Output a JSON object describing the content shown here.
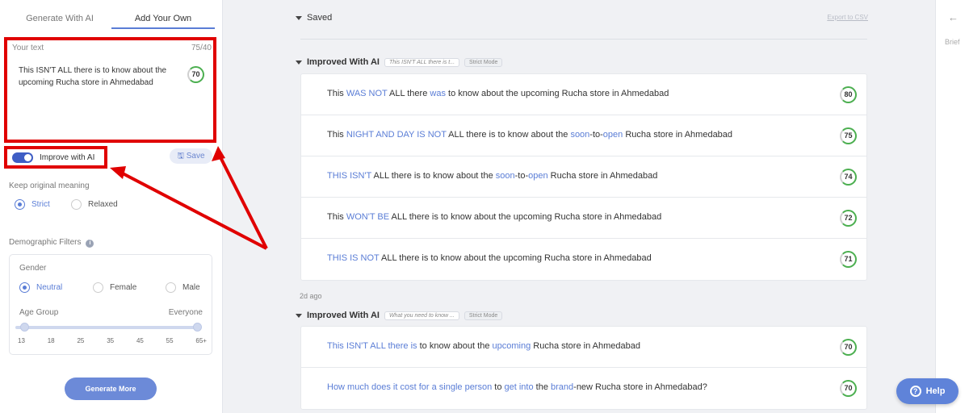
{
  "left": {
    "tabs": [
      "Generate With AI",
      "Add Your Own"
    ],
    "text_label": "Your text",
    "char_count": "75/40",
    "text_value": "This ISN'T ALL there is to know about the upcoming Rucha store in Ahmedabad",
    "text_score": "70",
    "improve_label": "Improve with AI",
    "save_label": "Save",
    "keep_meaning_label": "Keep original meaning",
    "meaning_options": [
      "Strict",
      "Relaxed"
    ],
    "demographic_label": "Demographic Filters",
    "gender_label": "Gender",
    "gender_options": [
      "Neutral",
      "Female",
      "Male"
    ],
    "age_label": "Age Group",
    "age_value": "Everyone",
    "age_ticks": [
      "13",
      "18",
      "25",
      "35",
      "45",
      "55",
      "65+"
    ],
    "generate_label": "Generate More"
  },
  "main": {
    "saved_label": "Saved",
    "export_label": "Export to CSV",
    "group1": {
      "title": "Improved With AI",
      "chip": "This ISN'T ALL there is t...",
      "mode": "Strict Mode"
    },
    "group1_rows": [
      {
        "score": "80",
        "parts": [
          [
            "This ",
            0
          ],
          [
            "WAS NOT",
            1
          ],
          [
            " ALL there ",
            0
          ],
          [
            "was",
            1
          ],
          [
            " to know about the upcoming Rucha store in Ahmedabad",
            0
          ]
        ]
      },
      {
        "score": "75",
        "parts": [
          [
            "This ",
            0
          ],
          [
            "NIGHT AND DAY IS NOT",
            1
          ],
          [
            " ALL there is to know about the ",
            0
          ],
          [
            "soon",
            1
          ],
          [
            "-to-",
            0
          ],
          [
            "open",
            1
          ],
          [
            " Rucha store in Ahmedabad",
            0
          ]
        ]
      },
      {
        "score": "74",
        "parts": [
          [
            "THIS ISN'T",
            1
          ],
          [
            " ALL there is to know about the ",
            0
          ],
          [
            "soon",
            1
          ],
          [
            "-to-",
            0
          ],
          [
            "open",
            1
          ],
          [
            " Rucha store in Ahmedabad",
            0
          ]
        ]
      },
      {
        "score": "72",
        "parts": [
          [
            "This ",
            0
          ],
          [
            "WON'T BE",
            1
          ],
          [
            " ALL there is to know about the upcoming Rucha store in Ahmedabad",
            0
          ]
        ]
      },
      {
        "score": "71",
        "parts": [
          [
            "THIS IS NOT",
            1
          ],
          [
            " ALL there is to know about the upcoming Rucha store in Ahmedabad",
            0
          ]
        ]
      }
    ],
    "ago_label": "2d ago",
    "group2": {
      "title": "Improved With AI",
      "chip": "What you need to know ...",
      "mode": "Strict Mode"
    },
    "group2_rows": [
      {
        "score": "70",
        "parts": [
          [
            "This ISN'T ALL there is",
            1
          ],
          [
            " to know about the ",
            0
          ],
          [
            "upcoming",
            1
          ],
          [
            " Rucha store in Ahmedabad",
            0
          ]
        ]
      },
      {
        "score": "70",
        "parts": [
          [
            "How much does it cost for a single person",
            1
          ],
          [
            " to ",
            0
          ],
          [
            "get into",
            1
          ],
          [
            " the ",
            0
          ],
          [
            "brand",
            1
          ],
          [
            "-new Rucha store in Ahmedabad?",
            0
          ]
        ]
      }
    ]
  },
  "rail": {
    "brief_label": "Brief",
    "back_icon": "arrow-left-icon"
  },
  "help_label": "Help",
  "colors": {
    "accent": "#5a7dd6",
    "annotation": "#e00000",
    "score_ring": "#4caf50"
  }
}
